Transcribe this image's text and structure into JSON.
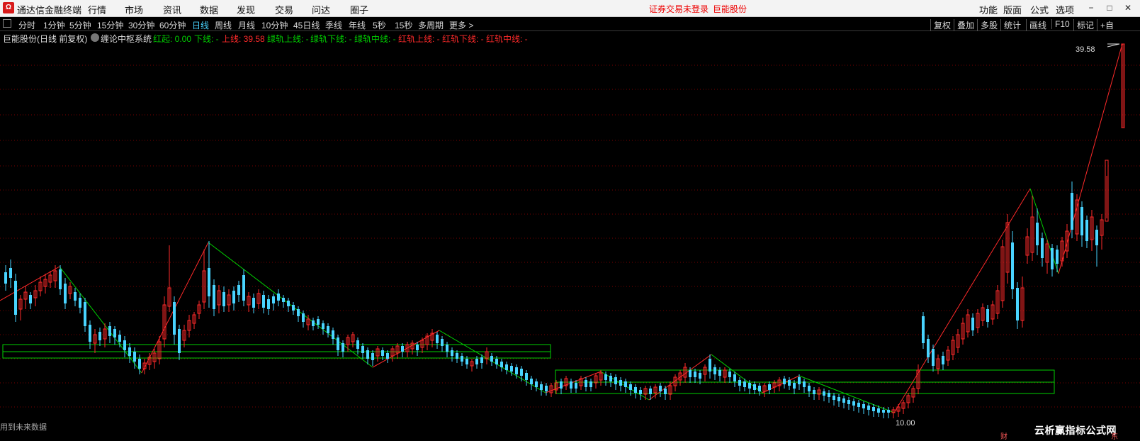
{
  "app": {
    "title": "通达信金融终端",
    "menus": [
      "行情",
      "市场",
      "资讯",
      "数据",
      "发现",
      "交易",
      "问达",
      "圈子"
    ],
    "warning": "证券交易未登录",
    "security_name": "巨能股份",
    "right_menus": [
      "功能",
      "版面",
      "公式",
      "选项"
    ]
  },
  "periods": [
    "分时",
    "1分钟",
    "5分钟",
    "15分钟",
    "30分钟",
    "60分钟",
    "日线",
    "周线",
    "月线",
    "10分钟",
    "45日线",
    "季线",
    "年线",
    "5秒",
    "15秒",
    "多周期",
    "更多 >"
  ],
  "active_period": "日线",
  "toolbar": [
    "复权",
    "叠加",
    "多股",
    "统计",
    "画线",
    "F10",
    "标记",
    "+自"
  ],
  "indicator": {
    "stock_title": "巨能股份(日线 前复权)",
    "system": "缠论中枢系统",
    "hong_qi": "红起: 0.00",
    "xia_xian": "下线: -",
    "shang_xian": "上线: 39.58",
    "lv_shang": "绿轨上线: -",
    "lv_xia": "绿轨下线: -",
    "lv_zhong": "绿轨中线: -",
    "hong_shang": "红轨上线: -",
    "hong_xia": "红轨下线: -",
    "hong_zhong": "红轨中线: -"
  },
  "chart": {
    "max_price_label": "39.58",
    "min_price_label": "10.00",
    "bottom_note": "用到未来数据",
    "watermark": "云析赢指标公式网",
    "tiny_mark_1": "财",
    "tiny_mark_2": "东"
  },
  "colors": {
    "up": "#ff2a2a",
    "down": "#49d4ff",
    "green_line": "#00d000",
    "red_line": "#ff2a2a",
    "grid": "#7a0000",
    "background": "#000000"
  },
  "chart_data": {
    "type": "candlestick",
    "title": "巨能股份(日线 前复权)",
    "indicator": "缠论中枢系统",
    "upper_line": 39.58,
    "lower_line": null,
    "max_label": 39.58,
    "min_label": 10.0,
    "legend": [
      "红起",
      "下线",
      "上线",
      "绿轨上线",
      "绿轨下线",
      "绿轨中线",
      "红轨上线",
      "红轨下线",
      "红轨中线"
    ],
    "grid": true
  }
}
